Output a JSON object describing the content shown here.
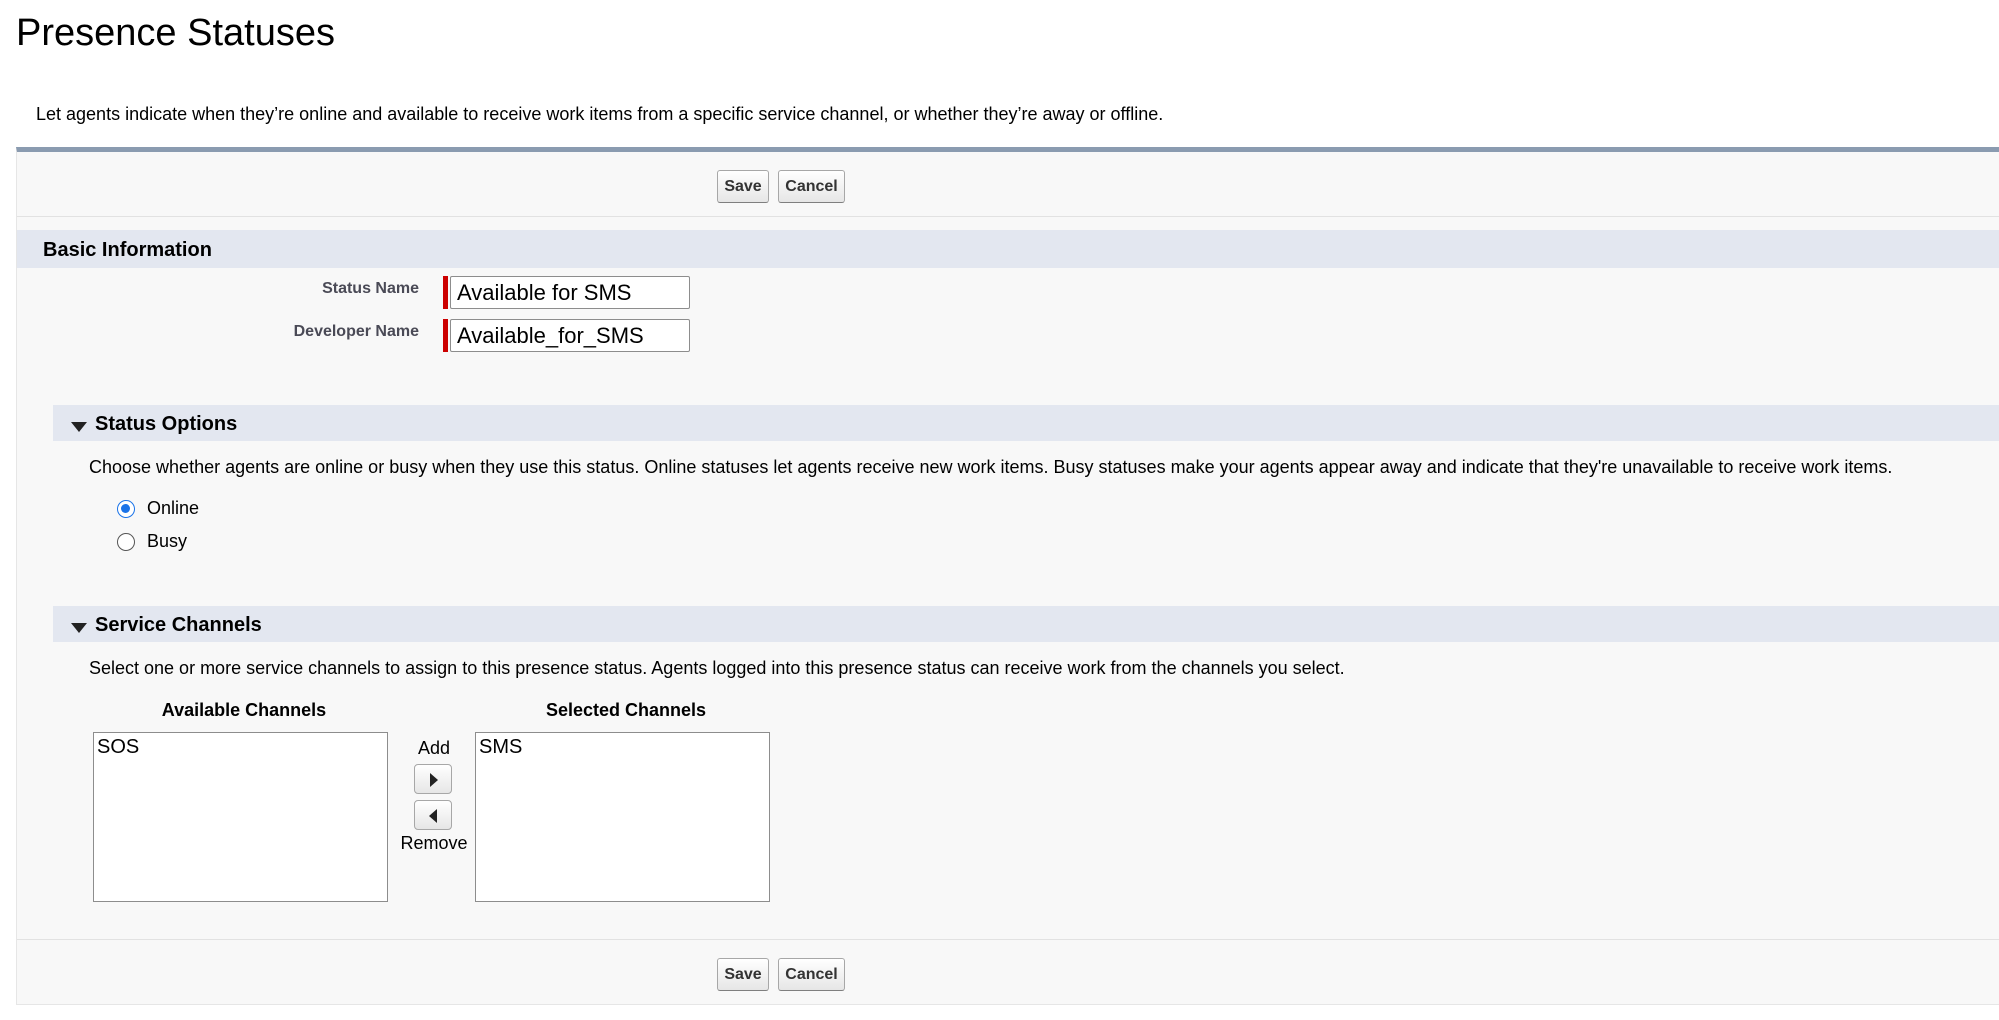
{
  "page": {
    "title": "Presence Statuses",
    "description": "Let agents indicate when they’re online and available to receive work items from a specific service channel, or whether they’re away or offline."
  },
  "buttons": {
    "save": "Save",
    "cancel": "Cancel"
  },
  "basic_info": {
    "header": "Basic Information",
    "status_name_label": "Status Name",
    "status_name_value": "Available for SMS",
    "developer_name_label": "Developer Name",
    "developer_name_value": "Available_for_SMS"
  },
  "status_options": {
    "header": "Status Options",
    "help": "Choose whether agents are online or busy when they use this status. Online statuses let agents receive new work items. Busy statuses make your agents appear away and indicate that they're unavailable to receive work items.",
    "options": [
      {
        "label": "Online",
        "selected": true
      },
      {
        "label": "Busy",
        "selected": false
      }
    ]
  },
  "service_channels": {
    "header": "Service Channels",
    "help": "Select one or more service channels to assign to this presence status. Agents logged into this presence status can receive work from the channels you select.",
    "available_title": "Available Channels",
    "selected_title": "Selected Channels",
    "available": [
      "SOS"
    ],
    "selected": [
      "SMS"
    ],
    "add_label": "Add",
    "remove_label": "Remove"
  },
  "colors": {
    "accent": "#1a73e8",
    "required": "#cc0000",
    "section_bg": "#e3e7f0",
    "panel_border": "#8a9bb0"
  }
}
